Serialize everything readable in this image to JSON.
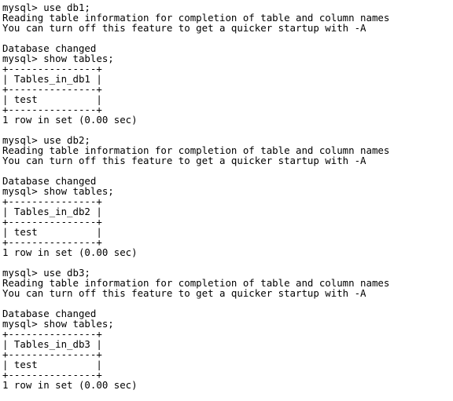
{
  "terminal": {
    "lines": [
      "mysql> use db1;",
      "Reading table information for completion of table and column names",
      "You can turn off this feature to get a quicker startup with -A",
      "",
      "Database changed",
      "mysql> show tables;",
      "+---------------+",
      "| Tables_in_db1 |",
      "+---------------+",
      "| test          |",
      "+---------------+",
      "1 row in set (0.00 sec)",
      "",
      "mysql> use db2;",
      "Reading table information for completion of table and column names",
      "You can turn off this feature to get a quicker startup with -A",
      "",
      "Database changed",
      "mysql> show tables;",
      "+---------------+",
      "| Tables_in_db2 |",
      "+---------------+",
      "| test          |",
      "+---------------+",
      "1 row in set (0.00 sec)",
      "",
      "mysql> use db3;",
      "Reading table information for completion of table and column names",
      "You can turn off this feature to get a quicker startup with -A",
      "",
      "Database changed",
      "mysql> show tables;",
      "+---------------+",
      "| Tables_in_db3 |",
      "+---------------+",
      "| test          |",
      "+---------------+",
      "1 row in set (0.00 sec)"
    ]
  },
  "colors": {
    "background": "#ffffff",
    "text": "#000000"
  }
}
